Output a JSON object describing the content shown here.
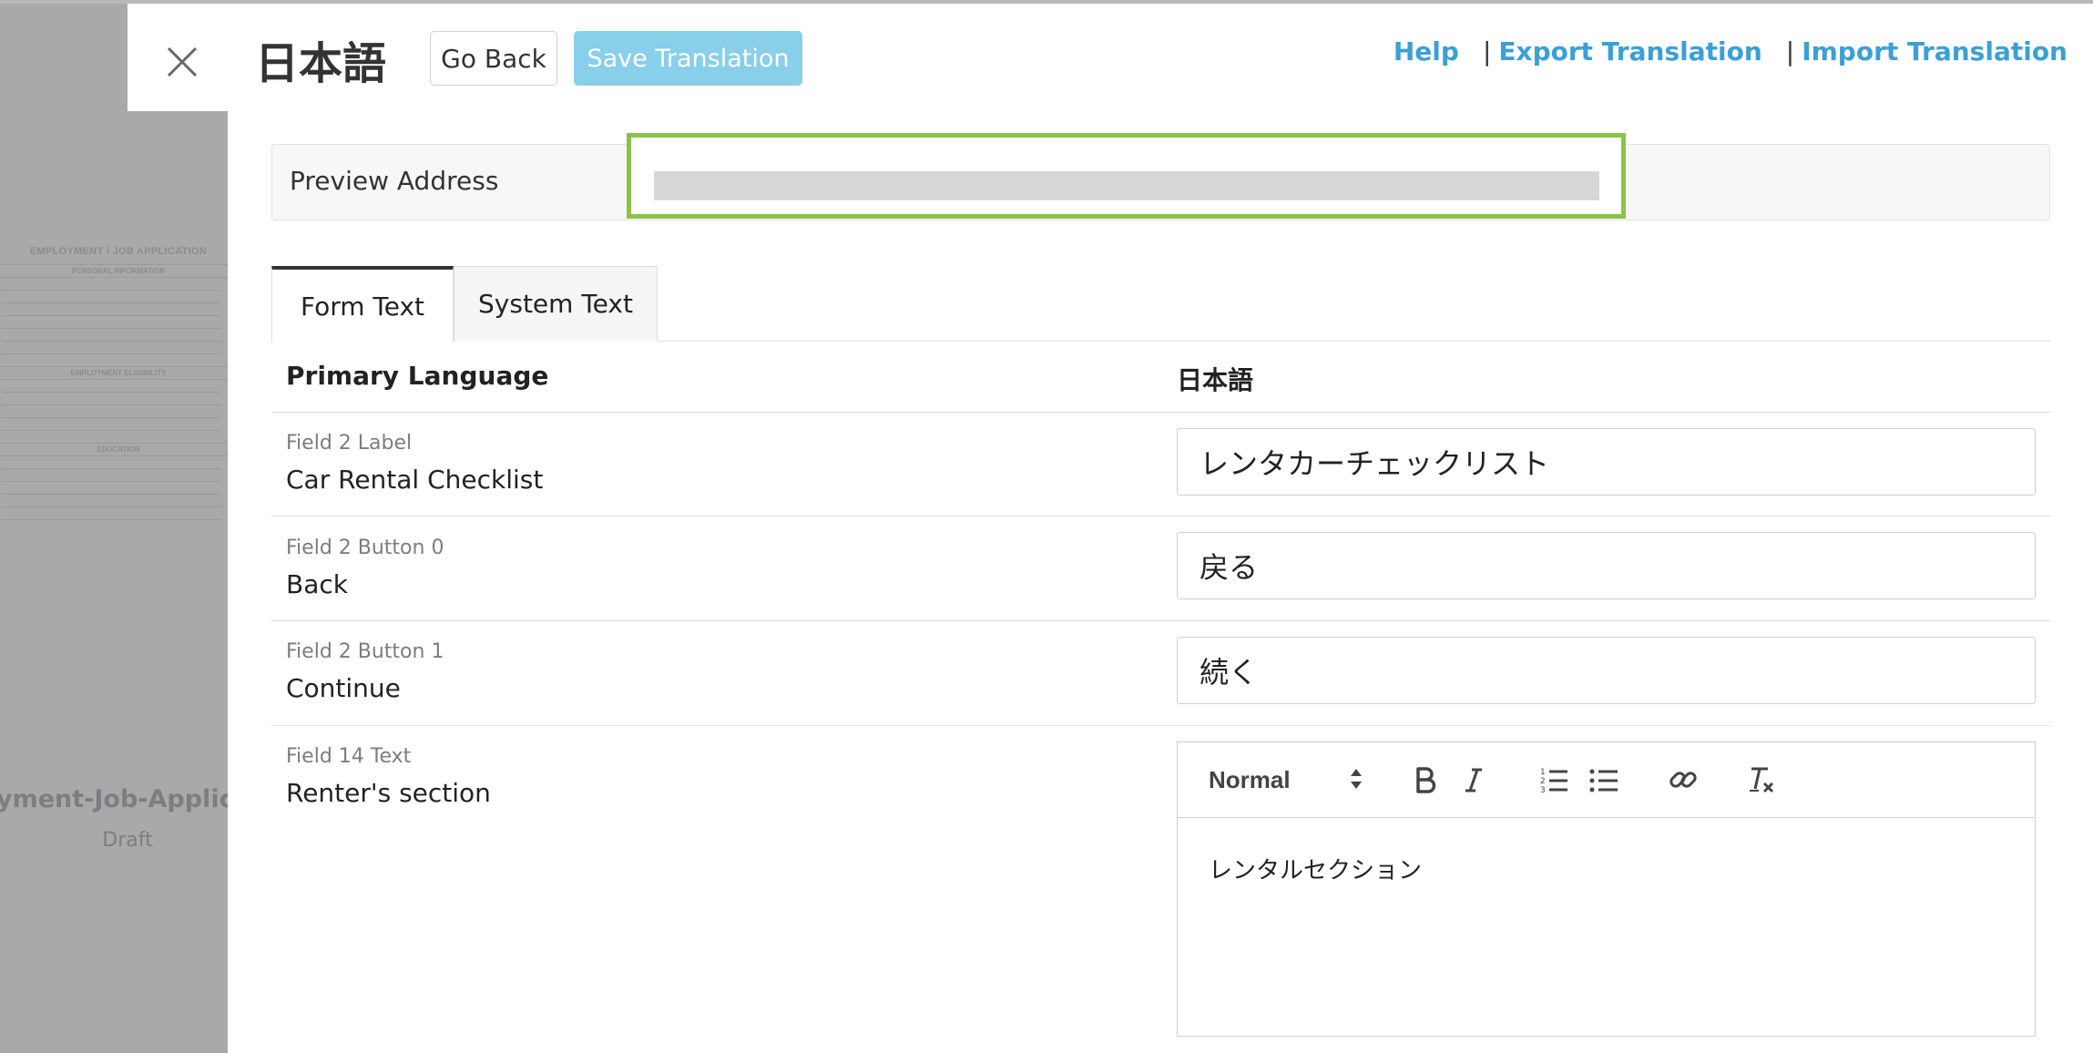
{
  "background_form": {
    "doc_title": "EMPLOYMENT / JOB APPLICATION",
    "sections": [
      "PERSONAL INFORMATION",
      "EMPLOYMENT ELIGIBILITY",
      "EDUCATION"
    ],
    "name": "yment-Job-Applica",
    "status": "Draft"
  },
  "header": {
    "language_title": "日本語",
    "go_back_label": "Go Back",
    "save_label": "Save Translation",
    "links": {
      "help": "Help",
      "export": "Export Translation",
      "import": "Import Translation",
      "separator": "|"
    }
  },
  "preview": {
    "label": "Preview Address"
  },
  "tabs": [
    {
      "label": "Form Text",
      "active": true
    },
    {
      "label": "System Text",
      "active": false
    }
  ],
  "table": {
    "headers": {
      "primary": "Primary Language",
      "translation": "日本語"
    },
    "rows": [
      {
        "field": "Field 2 Label",
        "source": "Car Rental Checklist",
        "translation": "レンタカーチェックリスト"
      },
      {
        "field": "Field 2 Button 0",
        "source": "Back",
        "translation": "戻る"
      },
      {
        "field": "Field 2 Button 1",
        "source": "Continue",
        "translation": "続く"
      },
      {
        "field": "Field 14 Text",
        "source": "Renter's section",
        "translation": "レンタルセクション"
      }
    ]
  },
  "editor": {
    "format_select": "Normal"
  },
  "colors": {
    "accent_link": "#3aa0d6",
    "save_button": "#88cfea",
    "highlight_border": "#8bc34a"
  }
}
